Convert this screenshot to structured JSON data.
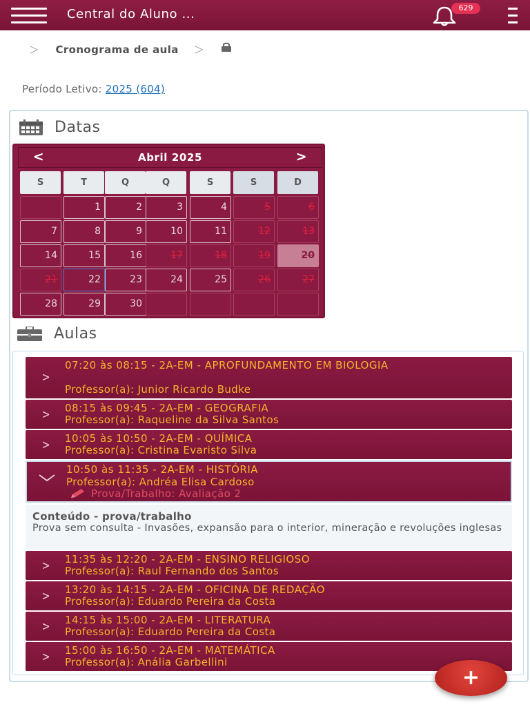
{
  "header": {
    "title": "Central do Aluno ...",
    "notification_count": "629"
  },
  "breadcrumb": {
    "current": "Cronograma de aula"
  },
  "period": {
    "label": "Período Letivo: ",
    "value": "2025 (604)"
  },
  "datas": {
    "heading": "Datas",
    "calendar": {
      "month_label": "Abril 2025",
      "prev": "<",
      "next": ">",
      "weekdays": [
        "S",
        "T",
        "Q",
        "Q",
        "S",
        "S",
        "D"
      ],
      "days": [
        [
          "",
          "1",
          "2",
          "3",
          "4",
          "5",
          "6"
        ],
        [
          "7",
          "8",
          "9",
          "10",
          "11",
          "12",
          "13"
        ],
        [
          "14",
          "15",
          "16",
          "17",
          "18",
          "19",
          "20"
        ],
        [
          "21",
          "22",
          "23",
          "24",
          "25",
          "26",
          "27"
        ],
        [
          "28",
          "29",
          "30",
          "",
          "",
          "",
          ""
        ]
      ],
      "selected_day": "22",
      "today_day": "20",
      "unavailable_days": [
        "5",
        "6",
        "12",
        "13",
        "17",
        "18",
        "19",
        "21",
        "26",
        "27"
      ]
    }
  },
  "aulas": {
    "heading": "Aulas",
    "items": [
      {
        "time": "07:20 às 08:15 - 2A-EM - APROFUNDAMENTO EM BIOLOGIA",
        "professor": "Professor(a): Junior Ricardo Budke"
      },
      {
        "time": "08:15 às 09:45 - 2A-EM - GEOGRAFIA",
        "professor": "Professor(a): Raqueline da Silva Santos"
      },
      {
        "time": "10:05 às 10:50 - 2A-EM - QUÍMICA",
        "professor": "Professor(a): Cristina Evaristo Silva"
      },
      {
        "time": "10:50 às 11:35 - 2A-EM - HISTÓRIA",
        "professor": "Professor(a): Andréa Elisa Cardoso",
        "exam": "Prova/Trabalho: Avaliação 2",
        "expanded": true
      },
      {
        "time": "11:35 às 12:20 - 2A-EM - ENSINO RELIGIOSO",
        "professor": "Professor(a): Raul Fernando dos Santos"
      },
      {
        "time": "13:20 às 14:15 - 2A-EM - OFICINA DE REDAÇÃO",
        "professor": "Professor(a): Eduardo Pereira da Costa"
      },
      {
        "time": "14:15 às 15:00 - 2A-EM - LITERATURA",
        "professor": "Professor(a): Eduardo Pereira da Costa"
      },
      {
        "time": "15:00 às 16:50 - 2A-EM - MATEMÁTICA",
        "professor": "Professor(a): Anália Garbellini"
      }
    ],
    "content": {
      "title": "Conteúdo - prova/trabalho",
      "text": "Prova sem consulta - Invasões, expansão para o interior, mineração e revoluções inglesas"
    }
  },
  "fab": {
    "label": "+"
  },
  "colors": {
    "brand": "#7a1437",
    "accent_text": "#f6b52a",
    "exam_text": "#e24d62",
    "link": "#1c6fb8",
    "fab": "#c62a24"
  },
  "icons": {
    "menu": "hamburger-icon",
    "bell": "bell-icon",
    "more": "kebab-icon",
    "lock": "lock-icon",
    "calendar": "calendar-icon",
    "briefcase": "briefcase-icon",
    "pencil": "pencil-icon",
    "plus": "plus-icon"
  }
}
